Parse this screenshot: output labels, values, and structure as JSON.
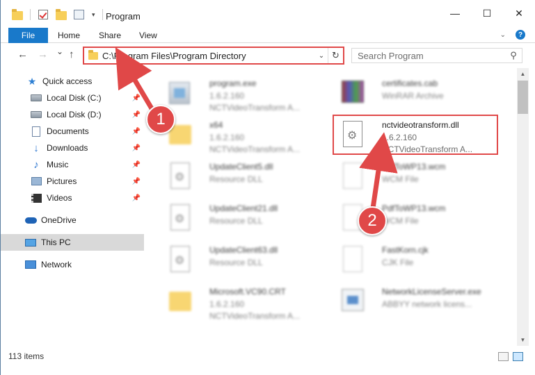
{
  "window": {
    "title": "Program",
    "minimize": "—",
    "maximize": "☐",
    "close": "✕"
  },
  "ribbon": {
    "file_tab": "File",
    "tabs": [
      "Home",
      "Share",
      "View"
    ],
    "expand_icon": "chevron-down-icon",
    "help": "?"
  },
  "navigation": {
    "back": "←",
    "forward": "→",
    "recent": "⌄",
    "up": "↑",
    "address": "C:\\Program Files\\Program Directory",
    "search_placeholder": "Search Program"
  },
  "sidebar": {
    "items": [
      {
        "label": "Quick access",
        "icon": "star-icon",
        "pinned": false
      },
      {
        "label": "Local Disk (C:)",
        "icon": "disk-icon",
        "pinned": true
      },
      {
        "label": "Local Disk (D:)",
        "icon": "disk-icon",
        "pinned": true
      },
      {
        "label": "Documents",
        "icon": "documents-icon",
        "pinned": true
      },
      {
        "label": "Downloads",
        "icon": "downloads-icon",
        "pinned": true
      },
      {
        "label": "Music",
        "icon": "music-icon",
        "pinned": true
      },
      {
        "label": "Pictures",
        "icon": "pictures-icon",
        "pinned": true
      },
      {
        "label": "Videos",
        "icon": "videos-icon",
        "pinned": true
      },
      {
        "label": "OneDrive",
        "icon": "onedrive-icon",
        "pinned": false
      },
      {
        "label": "This PC",
        "icon": "this-pc-icon",
        "pinned": false,
        "selected": true
      },
      {
        "label": "Network",
        "icon": "network-icon",
        "pinned": false
      }
    ]
  },
  "files": [
    {
      "name": "program.exe",
      "version": "1.6.2.160",
      "description": "NCTVideoTransform A...",
      "icon": "exe-icon",
      "blurred": true
    },
    {
      "name": "certificates.cab",
      "version": "WinRAR Archive",
      "description": "",
      "icon": "winrar-icon",
      "blurred": true
    },
    {
      "name": "x64",
      "version": "1.6.2.160",
      "description": "NCTVideoTransform A...",
      "icon": "folder-icon",
      "blurred": true
    },
    {
      "name": "nctvideotransform.dll",
      "version": "1.6.2.160",
      "description": "NCTVideoTransform A...",
      "icon": "dll-icon",
      "blurred": false
    },
    {
      "name": "UpdateClient5.dll",
      "version": "Resource DLL",
      "description": "",
      "icon": "dll-icon",
      "blurred": true
    },
    {
      "name": "PdfToWP13.wcm",
      "version": "WCM File",
      "description": "",
      "icon": "blank-file-icon",
      "blurred": true
    },
    {
      "name": "UpdateClient21.dll",
      "version": "Resource DLL",
      "description": "",
      "icon": "dll-icon",
      "blurred": true
    },
    {
      "name": "PdfToWP13.wcm",
      "version": "WCM File",
      "description": "",
      "icon": "blank-file-icon",
      "blurred": true
    },
    {
      "name": "UpdateClient63.dll",
      "version": "Resource DLL",
      "description": "",
      "icon": "dll-icon",
      "blurred": true
    },
    {
      "name": "FastKorn.cjk",
      "version": "CJK File",
      "description": "",
      "icon": "blank-file-icon",
      "blurred": true
    },
    {
      "name": "Microsoft.VC90.CRT",
      "version": "1.6.2.160",
      "description": "NCTVideoTransform A...",
      "icon": "folder-icon",
      "blurred": true
    },
    {
      "name": "NetworkLicenseServer.exe",
      "version": "ABBYY network licens...",
      "description": "",
      "icon": "network-exe-icon",
      "blurred": true
    }
  ],
  "status": {
    "item_count": "113 items"
  },
  "annotations": {
    "step1": "1",
    "step2": "2",
    "color": "#e04848"
  }
}
